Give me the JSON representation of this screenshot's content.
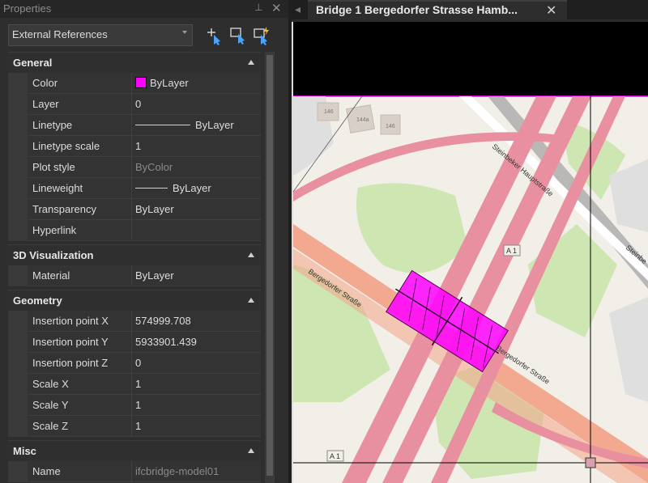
{
  "panel": {
    "title": "Properties",
    "selector_value": "External References"
  },
  "sections": {
    "general": "General",
    "viz": "3D Visualization",
    "geometry": "Geometry",
    "misc": "Misc"
  },
  "general": {
    "color_k": "Color",
    "color_v": "ByLayer",
    "layer_k": "Layer",
    "layer_v": "0",
    "linetype_k": "Linetype",
    "linetype_v": "ByLayer",
    "ltscale_k": "Linetype scale",
    "ltscale_v": "1",
    "plotstyle_k": "Plot style",
    "plotstyle_v": "ByColor",
    "lineweight_k": "Lineweight",
    "lineweight_v": "ByLayer",
    "transparency_k": "Transparency",
    "transparency_v": "ByLayer",
    "hyperlink_k": "Hyperlink",
    "hyperlink_v": ""
  },
  "viz": {
    "material_k": "Material",
    "material_v": "ByLayer"
  },
  "geometry": {
    "ipx_k": "Insertion point X",
    "ipx_v": "574999.708",
    "ipy_k": "Insertion point Y",
    "ipy_v": "5933901.439",
    "ipz_k": "Insertion point Z",
    "ipz_v": "0",
    "sx_k": "Scale X",
    "sx_v": "1",
    "sy_k": "Scale Y",
    "sy_v": "1",
    "sz_k": "Scale Z",
    "sz_v": "1"
  },
  "misc": {
    "name_k": "Name",
    "name_v": "ifcbridge-model01"
  },
  "document": {
    "tab_title": "Bridge 1 Bergedorfer Strasse Hamb..."
  },
  "map": {
    "labels": {
      "street1": "Steinbeker Hauptstraße",
      "street2": "Steinbe",
      "street3": "Bergedorfer Straße",
      "street4": "Bergedorfer Straße",
      "a1_top": "A 1",
      "a1_bottom": "A 1",
      "house1": "146",
      "house2": "144a",
      "house3": "146"
    }
  },
  "colors": {
    "accent": "#ff00ff",
    "bylayer_swatch": "#ff00ff"
  },
  "icons": [
    "pin-icon",
    "close-icon",
    "select-objects-icon",
    "quick-select-icon",
    "toggle-pickadd-icon",
    "chevron-down-icon",
    "collapse-icon"
  ]
}
